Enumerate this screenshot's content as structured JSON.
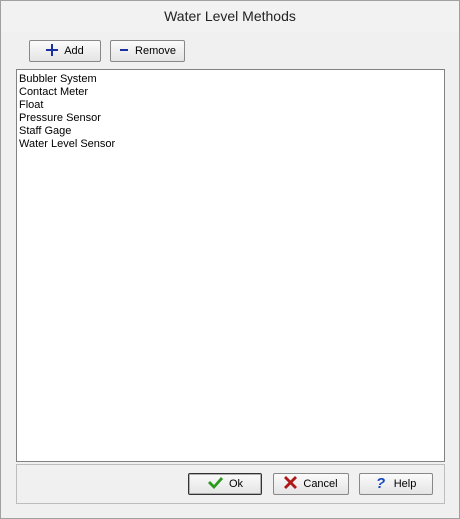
{
  "window": {
    "title": "Water Level Methods"
  },
  "toolbar": {
    "add_label": "Add",
    "remove_label": "Remove"
  },
  "methods": [
    "Bubbler System",
    "Contact Meter",
    "Float",
    "Pressure Sensor",
    "Staff Gage",
    "Water Level Sensor"
  ],
  "footer": {
    "ok_label": "Ok",
    "cancel_label": "Cancel",
    "help_label": "Help"
  },
  "icons": {
    "add": "plus-icon",
    "remove": "minus-icon",
    "ok": "checkmark-icon",
    "cancel": "x-icon",
    "help": "question-icon"
  },
  "colors": {
    "add_icon": "#1a2fa0",
    "ok_icon": "#2a9a1a",
    "cancel_icon": "#b01818",
    "help_icon": "#1a4ac0"
  }
}
